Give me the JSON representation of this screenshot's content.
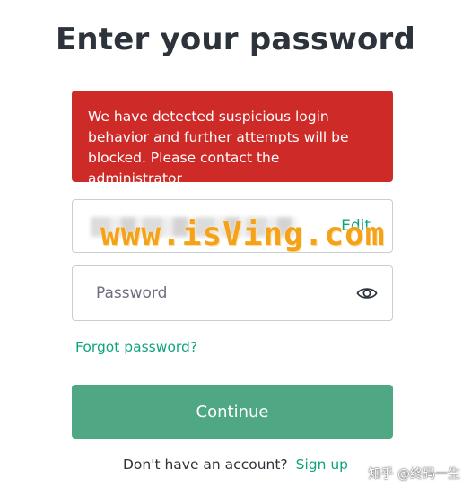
{
  "page": {
    "title": "Enter your password"
  },
  "alert": {
    "line1": "We have detected suspicious login",
    "line2": "behavior and further attempts will be",
    "line3": "blocked. Please contact the administrator",
    "color": "#cd2a28"
  },
  "email_field": {
    "edit_label": "Edit"
  },
  "password_field": {
    "placeholder": "Password",
    "toggle_icon": "eye-icon"
  },
  "forgot_password": {
    "label": "Forgot password?"
  },
  "continue_button": {
    "label": "Continue",
    "color": "#4fa883"
  },
  "signup": {
    "prompt": "Don't have an account?",
    "link_label": "Sign up"
  },
  "watermarks": {
    "site": "www.isVing.com",
    "zhihu": "知乎 @终码一生"
  },
  "colors": {
    "accent": "#10a37f",
    "title_text": "#2d333a"
  }
}
